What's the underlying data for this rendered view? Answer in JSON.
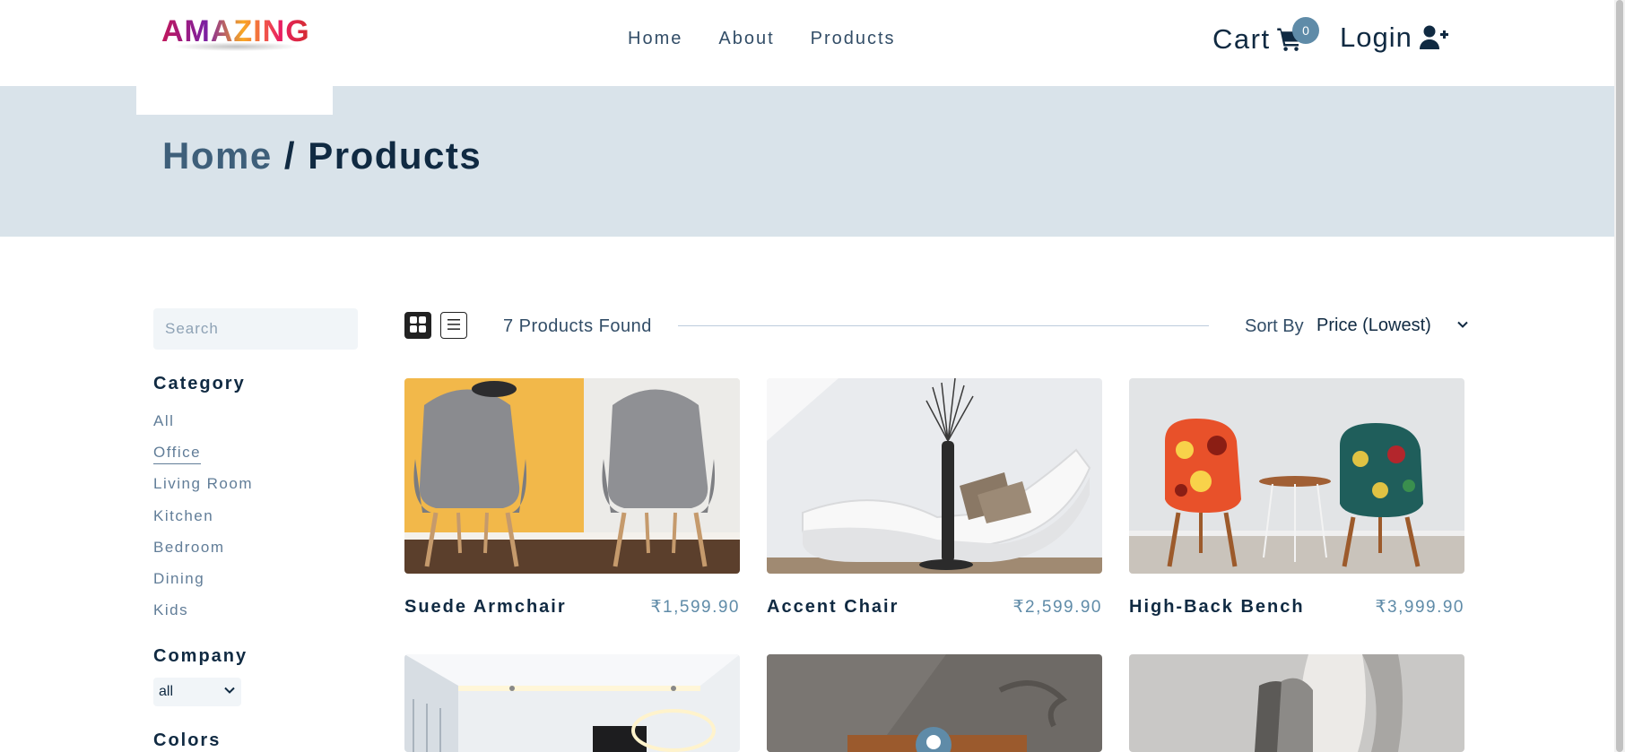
{
  "brand": {
    "logo_text": "AMAZING"
  },
  "nav": {
    "links": [
      {
        "label": "Home"
      },
      {
        "label": "About"
      },
      {
        "label": "Products"
      }
    ],
    "cart_label": "Cart",
    "cart_count": "0",
    "login_label": "Login"
  },
  "hero": {
    "breadcrumb_home": "Home",
    "breadcrumb_separator": " / ",
    "breadcrumb_current": "Products"
  },
  "filters": {
    "search_placeholder": "Search",
    "category_heading": "Category",
    "categories": [
      {
        "label": "All",
        "active": false
      },
      {
        "label": "Office",
        "active": true
      },
      {
        "label": "Living Room",
        "active": false
      },
      {
        "label": "Kitchen",
        "active": false
      },
      {
        "label": "Bedroom",
        "active": false
      },
      {
        "label": "Dining",
        "active": false
      },
      {
        "label": "Kids",
        "active": false
      }
    ],
    "company_heading": "Company",
    "company_selected": "all",
    "colors_heading": "Colors"
  },
  "toolbar": {
    "products_found": "7 Products Found",
    "sort_label": "Sort By",
    "sort_selected": "Price (Lowest)",
    "active_view": "grid"
  },
  "products": [
    {
      "name": "Suede Armchair",
      "price": "₹1,599.90"
    },
    {
      "name": "Accent Chair",
      "price": "₹2,599.90"
    },
    {
      "name": "High-Back Bench",
      "price": "₹3,999.90"
    }
  ],
  "colors": {
    "accent": "#5f8ba8",
    "hero_bg": "#d9e3ea",
    "text_dark": "#102a42",
    "text_muted": "#617d98"
  }
}
